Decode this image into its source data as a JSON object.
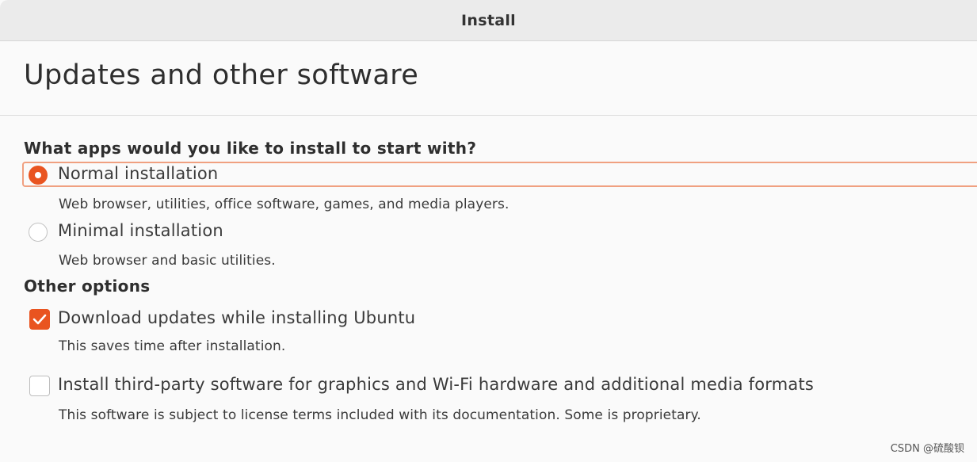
{
  "window": {
    "title": "Install"
  },
  "page": {
    "heading": "Updates and other software"
  },
  "apps_section": {
    "heading": "What apps would you like to install to start with?",
    "options": [
      {
        "label": "Normal installation",
        "description": "Web browser, utilities, office software, games, and media players.",
        "selected": true
      },
      {
        "label": "Minimal installation",
        "description": "Web browser and basic utilities.",
        "selected": false
      }
    ]
  },
  "other_section": {
    "heading": "Other options",
    "options": [
      {
        "label": "Download updates while installing Ubuntu",
        "description": "This saves time after installation.",
        "checked": true
      },
      {
        "label": "Install third-party software for graphics and Wi-Fi hardware and additional media formats",
        "description": "This software is subject to license terms included with its documentation. Some is proprietary.",
        "checked": false
      }
    ]
  },
  "watermark": "CSDN @硫酸钡",
  "colors": {
    "accent": "#e95420",
    "focus_ring": "#f0a080"
  }
}
